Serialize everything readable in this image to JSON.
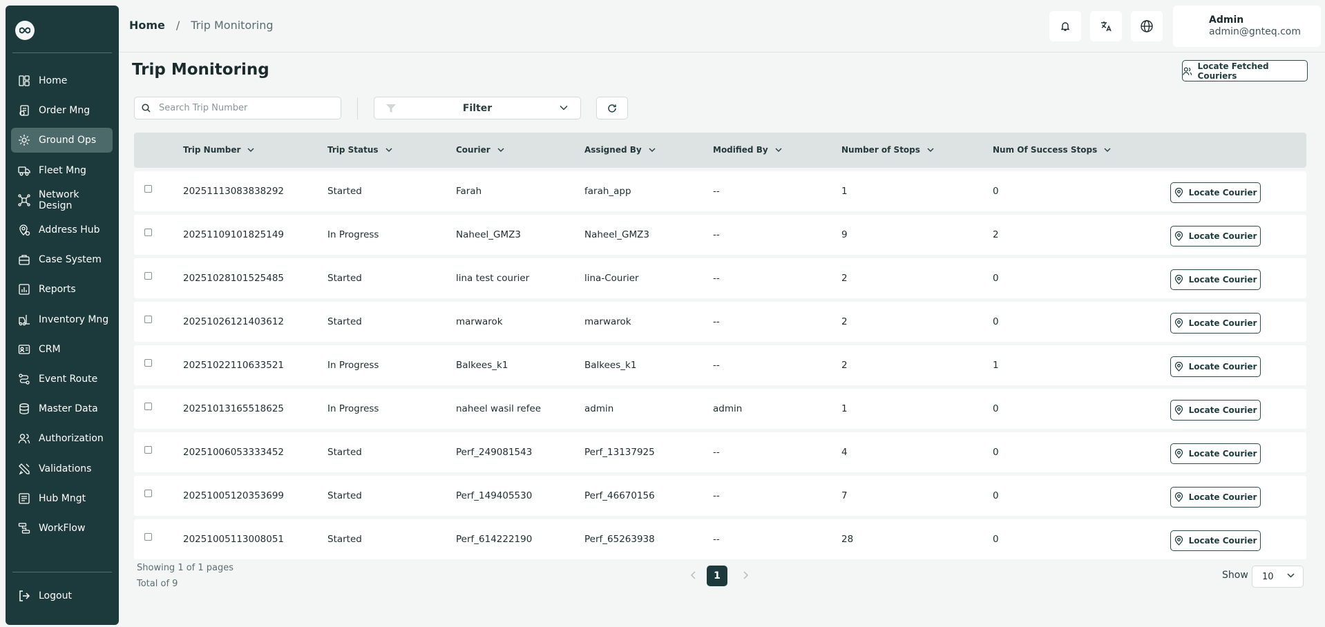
{
  "sidebar": {
    "items": [
      {
        "label": "Home",
        "icon": "dashboard-icon"
      },
      {
        "label": "Order Mng",
        "icon": "order-icon"
      },
      {
        "label": "Ground Ops",
        "icon": "ground-ops-icon",
        "active": true
      },
      {
        "label": "Fleet Mng",
        "icon": "truck-icon"
      },
      {
        "label": "Network Design",
        "icon": "network-icon"
      },
      {
        "label": "Address Hub",
        "icon": "location-pin-icon"
      },
      {
        "label": "Case System",
        "icon": "case-icon"
      },
      {
        "label": "Reports",
        "icon": "report-icon"
      },
      {
        "label": "Inventory Mng",
        "icon": "forklift-icon"
      },
      {
        "label": "CRM",
        "icon": "crm-icon"
      },
      {
        "label": "Event Route",
        "icon": "route-icon"
      },
      {
        "label": "Master Data",
        "icon": "database-icon"
      },
      {
        "label": "Authorization",
        "icon": "users-icon"
      },
      {
        "label": "Validations",
        "icon": "validation-icon"
      },
      {
        "label": "Hub Mngt",
        "icon": "hub-icon"
      },
      {
        "label": "WorkFlow",
        "icon": "workflow-icon"
      }
    ],
    "logout": "Logout"
  },
  "topbar": {
    "breadcrumb_home": "Home",
    "breadcrumb_sep": "/",
    "breadcrumb_current": "Trip Monitoring",
    "user_name": "Admin",
    "user_email": "admin@gnteq.com"
  },
  "page": {
    "title": "Trip Monitoring",
    "locate_fetched_label": "Locate Fetched Couriers",
    "search_placeholder": "Search Trip Number",
    "filter_label": "Filter"
  },
  "table": {
    "columns": [
      "Trip Number",
      "Trip Status",
      "Courier",
      "Assigned By",
      "Modified By",
      "Number of Stops",
      "Num Of Success Stops"
    ],
    "action_label": "Locate Courier",
    "rows": [
      [
        "20251113083838292",
        "Started",
        "Farah",
        "farah_app",
        "--",
        "1",
        "0"
      ],
      [
        "20251109101825149",
        "In Progress",
        "Naheel_GMZ3",
        "Naheel_GMZ3",
        "--",
        "9",
        "2"
      ],
      [
        "20251028101525485",
        "Started",
        "lina test courier",
        "lina-Courier",
        "--",
        "2",
        "0"
      ],
      [
        "20251026121403612",
        "Started",
        "marwarok",
        "marwarok",
        "--",
        "2",
        "0"
      ],
      [
        "20251022110633521",
        "In Progress",
        "Balkees_k1",
        "Balkees_k1",
        "--",
        "2",
        "1"
      ],
      [
        "20251013165518625",
        "In Progress",
        "naheel wasil refee",
        "admin",
        "admin",
        "1",
        "0"
      ],
      [
        "20251006053333452",
        "Started",
        "Perf_249081543",
        "Perf_13137925",
        "--",
        "4",
        "0"
      ],
      [
        "20251005120353699",
        "Started",
        "Perf_149405530",
        "Perf_46670156",
        "--",
        "7",
        "0"
      ],
      [
        "20251005113008051",
        "Started",
        "Perf_614222190",
        "Perf_65263938",
        "--",
        "28",
        "0"
      ]
    ]
  },
  "footer": {
    "showing": "Showing 1 of 1 pages",
    "total": "Total of 9",
    "current_page": "1",
    "show_label": "Show",
    "page_size": "10"
  },
  "colors": {
    "sidebar_bg": "#1c3a3c",
    "active_nav": "#4d6a6b",
    "table_header": "#dde2e2",
    "page_bg": "#f4f5f5"
  }
}
